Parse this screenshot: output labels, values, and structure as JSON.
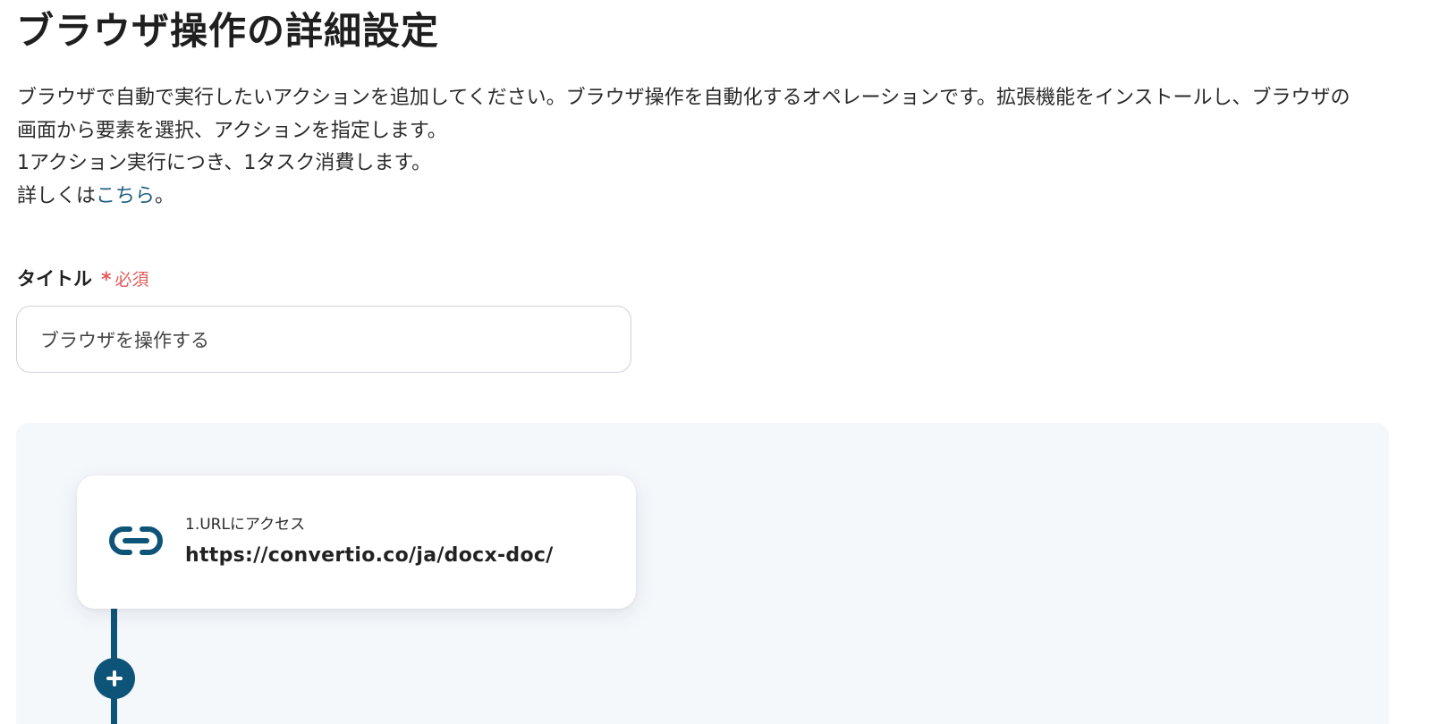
{
  "page": {
    "title": "ブラウザ操作の詳細設定"
  },
  "description": {
    "line1": "ブラウザで自動で実行したいアクションを追加してください。ブラウザ操作を自動化するオペレーションです。拡張機能をインストールし、ブラウザの",
    "line2": "画面から要素を選択、アクションを指定します。",
    "line3": "1アクション実行につき、1タスク消費します。",
    "line4_prefix": "詳しくは",
    "line4_link": "こちら",
    "line4_suffix": "。"
  },
  "title_field": {
    "label": "タイトル",
    "required_mark": "*",
    "required_text": "必須",
    "value": "ブラウザを操作する"
  },
  "workflow": {
    "steps": [
      {
        "label": "1.URLにアクセス",
        "value": "https://convertio.co/ja/docx-doc/",
        "icon": "link-icon"
      }
    ],
    "add_icon": "plus-icon"
  },
  "colors": {
    "accent": "#0e5478",
    "link": "#1e5f80",
    "required": "#e45b5b",
    "canvas_bg": "#f5f8fb",
    "input_border": "#cfd2de"
  }
}
